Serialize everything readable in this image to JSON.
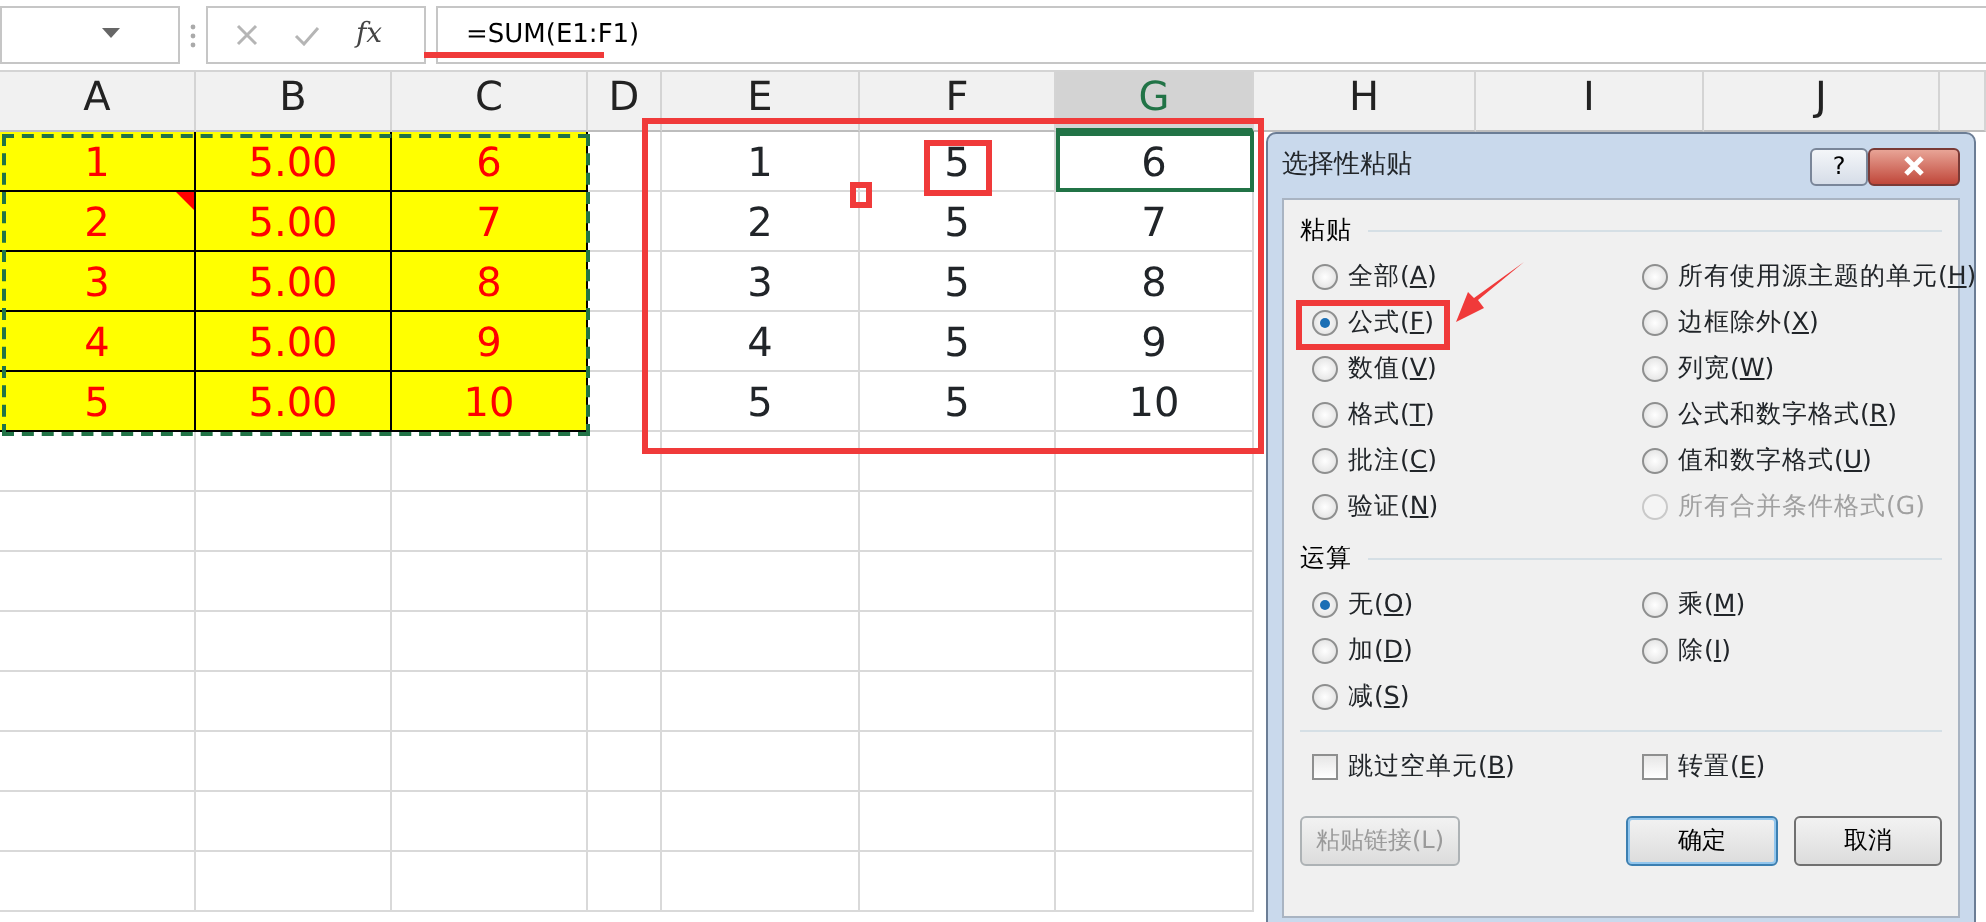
{
  "formula_bar": {
    "function_label": "fx",
    "formula": "=SUM(E1:F1)"
  },
  "columns": [
    {
      "label": "A",
      "selected": false
    },
    {
      "label": "B",
      "selected": false
    },
    {
      "label": "C",
      "selected": false
    },
    {
      "label": "D",
      "selected": false
    },
    {
      "label": "E",
      "selected": false
    },
    {
      "label": "F",
      "selected": false
    },
    {
      "label": "G",
      "selected": true
    },
    {
      "label": "H",
      "selected": false
    },
    {
      "label": "I",
      "selected": false
    },
    {
      "label": "J",
      "selected": false
    }
  ],
  "rows": [
    {
      "source": [
        {
          "text": "1",
          "comment": false
        },
        {
          "text": "5.00",
          "comment": false
        },
        {
          "text": "6",
          "comment": false
        }
      ],
      "results": [
        {
          "text": "1",
          "selected": false
        },
        {
          "text": "5",
          "selected": false
        },
        {
          "text": "6",
          "selected": true
        }
      ]
    },
    {
      "source": [
        {
          "text": "2",
          "comment": true
        },
        {
          "text": "5.00",
          "comment": false
        },
        {
          "text": "7",
          "comment": false
        }
      ],
      "results": [
        {
          "text": "2",
          "selected": false
        },
        {
          "text": "5",
          "selected": false
        },
        {
          "text": "7",
          "selected": false
        }
      ]
    },
    {
      "source": [
        {
          "text": "3",
          "comment": false
        },
        {
          "text": "5.00",
          "comment": false
        },
        {
          "text": "8",
          "comment": false
        }
      ],
      "results": [
        {
          "text": "3",
          "selected": false
        },
        {
          "text": "5",
          "selected": false
        },
        {
          "text": "8",
          "selected": false
        }
      ]
    },
    {
      "source": [
        {
          "text": "4",
          "comment": false
        },
        {
          "text": "5.00",
          "comment": false
        },
        {
          "text": "9",
          "comment": false
        }
      ],
      "results": [
        {
          "text": "4",
          "selected": false
        },
        {
          "text": "5",
          "selected": false
        },
        {
          "text": "9",
          "selected": false
        }
      ]
    },
    {
      "source": [
        {
          "text": "5",
          "comment": false
        },
        {
          "text": "5.00",
          "comment": false
        },
        {
          "text": "10",
          "comment": false
        }
      ],
      "results": [
        {
          "text": "5",
          "selected": false
        },
        {
          "text": "5",
          "selected": false
        },
        {
          "text": "10",
          "selected": false
        }
      ]
    }
  ],
  "dialog": {
    "title": "选择性粘贴",
    "help": "?",
    "paste_label": "粘贴",
    "paste_options": [
      {
        "label": "全部(A)",
        "selected": false,
        "disabled": false
      },
      {
        "label": "所有使用源主题的单元(H)",
        "selected": false,
        "disabled": false
      },
      {
        "label": "公式(F)",
        "selected": true,
        "disabled": false
      },
      {
        "label": "边框除外(X)",
        "selected": false,
        "disabled": false
      },
      {
        "label": "数值(V)",
        "selected": false,
        "disabled": false
      },
      {
        "label": "列宽(W)",
        "selected": false,
        "disabled": false
      },
      {
        "label": "格式(T)",
        "selected": false,
        "disabled": false
      },
      {
        "label": "公式和数字格式(R)",
        "selected": false,
        "disabled": false
      },
      {
        "label": "批注(C)",
        "selected": false,
        "disabled": false
      },
      {
        "label": "值和数字格式(U)",
        "selected": false,
        "disabled": false
      },
      {
        "label": "验证(N)",
        "selected": false,
        "disabled": false
      },
      {
        "label": "所有合并条件格式(G)",
        "selected": false,
        "disabled": true
      }
    ],
    "operation_label": "运算",
    "operation_options": [
      {
        "label": "无(O)",
        "selected": true
      },
      {
        "label": "乘(M)",
        "selected": false
      },
      {
        "label": "加(D)",
        "selected": false
      },
      {
        "label": "除(I)",
        "selected": false
      },
      {
        "label": "减(S)",
        "selected": false
      }
    ],
    "checkboxes": [
      {
        "label": "跳过空单元(B)",
        "checked": false
      },
      {
        "label": "转置(E)",
        "checked": false
      }
    ],
    "buttons": [
      {
        "label": "粘贴链接(L)",
        "kind": "disabled"
      },
      {
        "label": "确定",
        "kind": "default"
      },
      {
        "label": "取消",
        "kind": "normal"
      }
    ]
  }
}
